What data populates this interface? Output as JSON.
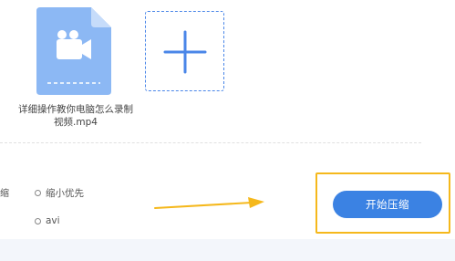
{
  "file": {
    "name": "详细操作教你电脑怎么录制视频.mp4",
    "icon": "video-file-icon"
  },
  "add_tile": {
    "icon": "plus-icon"
  },
  "cut_label": "缩",
  "options": [
    {
      "label": "缩小优先"
    },
    {
      "label": "avi"
    }
  ],
  "start_button": {
    "label": "开始压缩"
  },
  "colors": {
    "accent": "#3b82e3",
    "file_icon": "#8cb8f4",
    "highlight": "#f5b81c"
  }
}
